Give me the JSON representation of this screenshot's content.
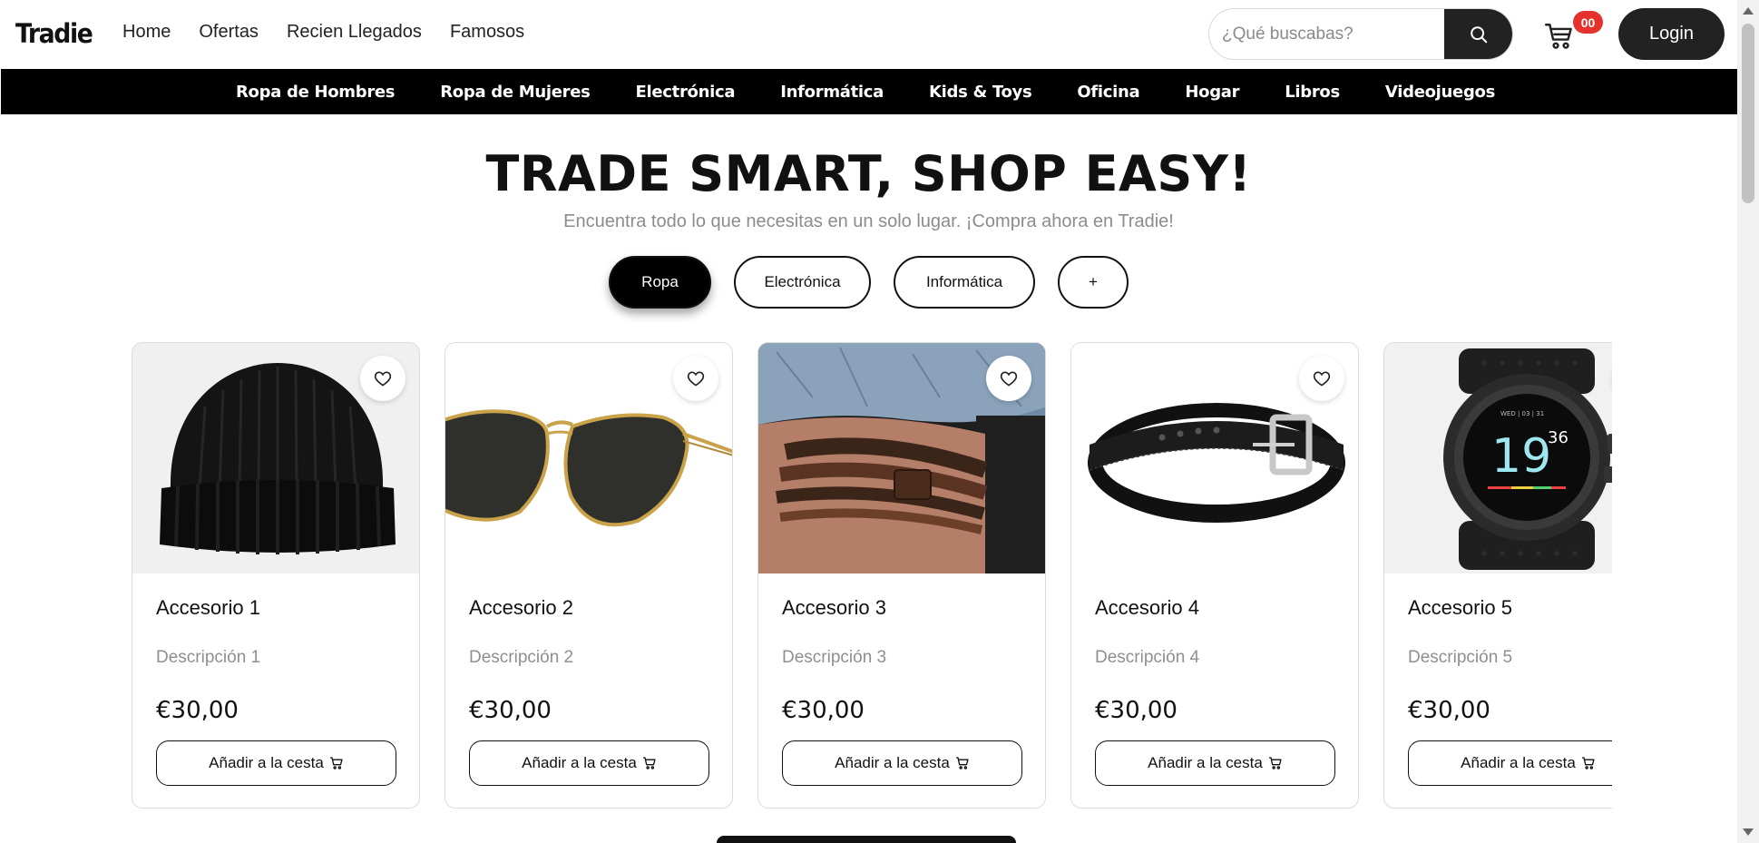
{
  "header": {
    "logo": "Tradie",
    "nav": [
      "Home",
      "Ofertas",
      "Recien Llegados",
      "Famosos"
    ],
    "search_placeholder": "¿Qué buscabas?",
    "cart_count": "00",
    "login_label": "Login"
  },
  "categories": [
    "Ropa de Hombres",
    "Ropa de Mujeres",
    "Electrónica",
    "Informática",
    "Kids & Toys",
    "Oficina",
    "Hogar",
    "Libros",
    "Videojuegos"
  ],
  "hero": {
    "title": "TRADE SMART, SHOP EASY!",
    "subtitle": "Encuentra todo lo que necesitas en un solo lugar. ¡Compra ahora en Tradie!"
  },
  "filters": [
    {
      "label": "Ropa",
      "active": true
    },
    {
      "label": "Electrónica",
      "active": false
    },
    {
      "label": "Informática",
      "active": false
    },
    {
      "label": "+",
      "active": false
    }
  ],
  "products": [
    {
      "title": "Accesorio 1",
      "description": "Descripción 1",
      "price": "€30,00",
      "button": "Añadir a la cesta",
      "image": "beanie-hat"
    },
    {
      "title": "Accesorio 2",
      "description": "Descripción 2",
      "price": "€30,00",
      "button": "Añadir a la cesta",
      "image": "aviator-sunglasses"
    },
    {
      "title": "Accesorio 3",
      "description": "Descripción 3",
      "price": "€30,00",
      "button": "Añadir a la cesta",
      "image": "leather-bracelet"
    },
    {
      "title": "Accesorio 4",
      "description": "Descripción 4",
      "price": "€30,00",
      "button": "Añadir a la cesta",
      "image": "leather-belt"
    },
    {
      "title": "Accesorio 5",
      "description": "Descripción 5",
      "price": "€30,00",
      "button": "Añadir a la cesta",
      "image": "smart-watch"
    }
  ],
  "colors": {
    "primary": "#000000",
    "badge": "#e5322d",
    "muted_text": "#8c8c8c"
  }
}
